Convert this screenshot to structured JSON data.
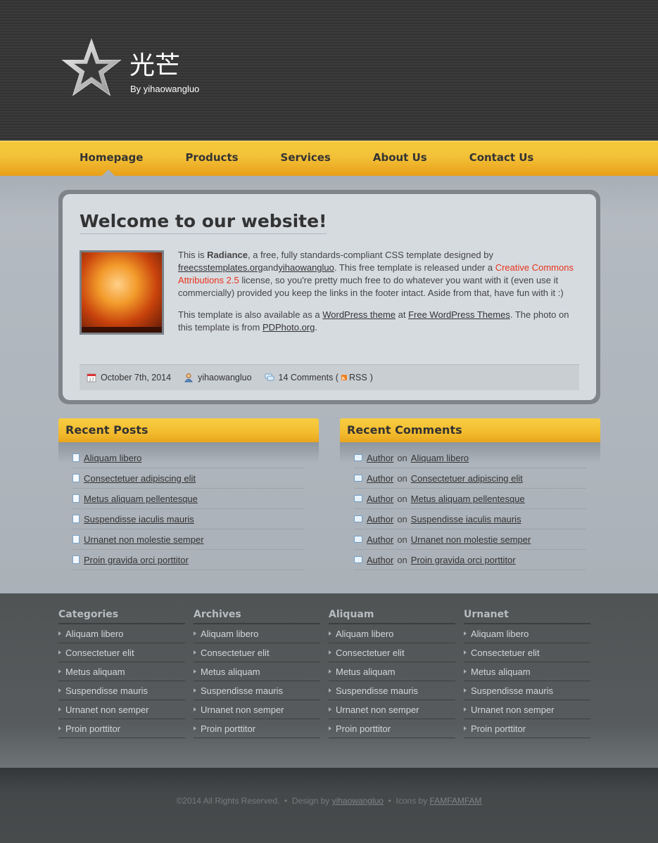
{
  "header": {
    "title": "光芒",
    "subtitle": "By yihaowangluo"
  },
  "menu": [
    "Homepage",
    "Products",
    "Services",
    "About Us",
    "Contact Us"
  ],
  "post": {
    "title": "Welcome to our website!",
    "p1_a": "This is ",
    "p1_bold": "Radiance",
    "p1_b": ", a free, fully standards-compliant CSS template designed by ",
    "p1_link1": "freecsstemplates.org",
    "p1_and": "and",
    "p1_link2": "yihaowangluo",
    "p1_c": ". This free template is released under a ",
    "p1_red": "Creative Commons Attributions 2.5",
    "p1_d": " license, so you're pretty much free to do whatever you want with it (even use it commercially) provided you keep the links in the footer intact. Aside from that, have fun with it :)",
    "p2_a": "This template is also available as a ",
    "p2_link1": "WordPress theme",
    "p2_b": " at ",
    "p2_link2": "Free WordPress Themes",
    "p2_c": ". The photo on this template is from ",
    "p2_link3": "PDPhoto.org",
    "p2_d": ".",
    "date": "October 7th, 2014",
    "author": "yihaowangluo",
    "comments": "14 Comments (",
    "rss": "RSS",
    "close_paren": ")"
  },
  "recent_posts": {
    "title": "Recent Posts",
    "items": [
      "Aliquam libero",
      "Consectetuer adipiscing elit",
      "Metus aliquam pellentesque",
      "Suspendisse iaculis mauris",
      "Urnanet non molestie semper",
      "Proin gravida orci porttitor"
    ]
  },
  "recent_comments": {
    "title": "Recent Comments",
    "author": "Author",
    "on": "on",
    "items": [
      "Aliquam libero",
      "Consectetuer adipiscing elit",
      "Metus aliquam pellentesque",
      "Suspendisse iaculis mauris",
      "Urnanet non molestie semper",
      "Proin gravida orci porttitor"
    ]
  },
  "footer_cols": [
    {
      "title": "Categories",
      "items": [
        "Aliquam libero",
        "Consectetuer elit",
        "Metus aliquam",
        "Suspendisse mauris",
        "Urnanet non semper",
        "Proin porttitor"
      ]
    },
    {
      "title": "Archives",
      "items": [
        "Aliquam libero",
        "Consectetuer elit",
        "Metus aliquam",
        "Suspendisse mauris",
        "Urnanet non semper",
        "Proin porttitor"
      ]
    },
    {
      "title": "Aliquam",
      "items": [
        "Aliquam libero",
        "Consectetuer elit",
        "Metus aliquam",
        "Suspendisse mauris",
        "Urnanet non semper",
        "Proin porttitor"
      ]
    },
    {
      "title": "Urnanet",
      "items": [
        "Aliquam libero",
        "Consectetuer elit",
        "Metus aliquam",
        "Suspendisse mauris",
        "Urnanet non semper",
        "Proin porttitor"
      ]
    }
  ],
  "copyright": {
    "text": "©2014 All Rights Reserved.  •  Design by ",
    "design_link": "yihaowangluo",
    "icons_text": "  •  Icons by ",
    "icons_link": "FAMFAMFAM"
  }
}
